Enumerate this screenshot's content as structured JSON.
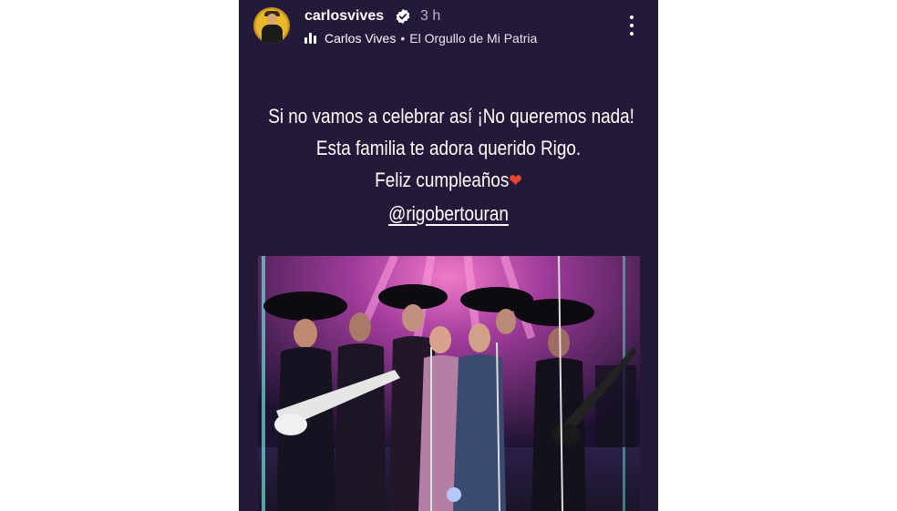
{
  "post": {
    "username": "carlosvives",
    "time": "3 h",
    "music_artist": "Carlos Vives",
    "separator": "•",
    "music_title": "El Orgullo de Mi Patria"
  },
  "caption": {
    "line1": "Si no vamos a celebrar así ¡No queremos nada!",
    "line2": "Esta familia te adora querido Rigo.",
    "line3": "Feliz cumpleaños",
    "heart": "❤",
    "mention": "@rigobertouran"
  },
  "icons": {
    "verified": "verified-badge-icon",
    "music": "music-bars-icon",
    "more": "more-vertical-icon",
    "avatar": "profile-avatar"
  },
  "colors": {
    "story_bg": "#241939",
    "text": "#ffffff",
    "time": "#bcb6c8",
    "heart": "#e8452f",
    "avatar_ring": "#e9b72a"
  }
}
